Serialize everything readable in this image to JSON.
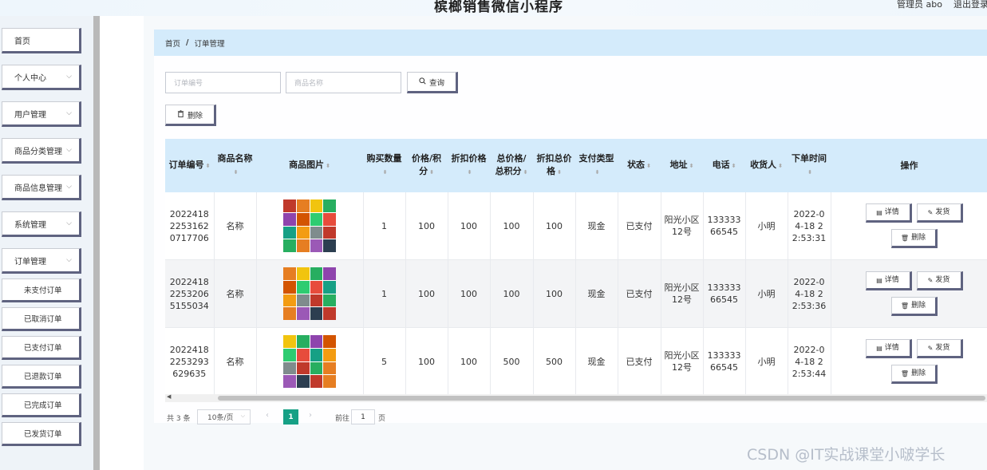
{
  "header": {
    "title": "槟榔销售微信小程序",
    "user": "管理员 abo",
    "logout": "退出登录"
  },
  "sidebar": {
    "items": [
      {
        "label": "首页",
        "has_chevron": false
      },
      {
        "label": "个人中心",
        "has_chevron": true
      },
      {
        "label": "用户管理",
        "has_chevron": true
      },
      {
        "label": "商品分类管理",
        "has_chevron": true
      },
      {
        "label": "商品信息管理",
        "has_chevron": true
      },
      {
        "label": "系统管理",
        "has_chevron": true
      },
      {
        "label": "订单管理",
        "has_chevron": true
      }
    ],
    "sub_items": [
      "未支付订单",
      "已取消订单",
      "已支付订单",
      "已退款订单",
      "已完成订单",
      "已发货订单"
    ]
  },
  "breadcrumb": {
    "home": "首页",
    "separator": "/",
    "current": "订单管理"
  },
  "search": {
    "order_no_placeholder": "订单编号",
    "product_name_placeholder": "商品名称",
    "query_label": "查询",
    "delete_label": "删除"
  },
  "table": {
    "headers": [
      "订单编号",
      "商品名称",
      "商品图片",
      "购买数量",
      "价格/积分",
      "折扣价格",
      "总价格/总积分",
      "折扣总价格",
      "支付类型",
      "状态",
      "地址",
      "电话",
      "收货人",
      "下单时间",
      "操作"
    ],
    "rows": [
      {
        "order_no": "202241822531620717706",
        "name": "名称",
        "qty": "1",
        "price": "100",
        "discount": "100",
        "total": "100",
        "discount_total": "100",
        "pay_type": "现金",
        "status": "已支付",
        "address": "阳光小区12号",
        "phone": "13333366545",
        "receiver": "小明",
        "time": "2022-04-18 22:53:31"
      },
      {
        "order_no": "202241822532065155034",
        "name": "名称",
        "qty": "1",
        "price": "100",
        "discount": "100",
        "total": "100",
        "discount_total": "100",
        "pay_type": "现金",
        "status": "已支付",
        "address": "阳光小区12号",
        "phone": "13333366545",
        "receiver": "小明",
        "time": "2022-04-18 22:53:36"
      },
      {
        "order_no": "20224182253293629635",
        "name": "名称",
        "qty": "5",
        "price": "100",
        "discount": "100",
        "total": "500",
        "discount_total": "500",
        "pay_type": "现金",
        "status": "已支付",
        "address": "阳光小区12号",
        "phone": "13333366545",
        "receiver": "小明",
        "time": "2022-04-18 22:53:44"
      }
    ],
    "actions": {
      "detail": "详情",
      "ship": "发货",
      "delete": "删除"
    }
  },
  "pagination": {
    "total": "共 3 条",
    "page_size": "10条/页",
    "current_page": "1",
    "goto_label": "前往",
    "goto_value": "1",
    "page_suffix": "页"
  },
  "watermark": "CSDN @IT实战课堂小啵学长",
  "colors": {
    "header_bg": "#d4ebfb",
    "active_page": "#16a085",
    "button_shadow": "#5f6380"
  }
}
